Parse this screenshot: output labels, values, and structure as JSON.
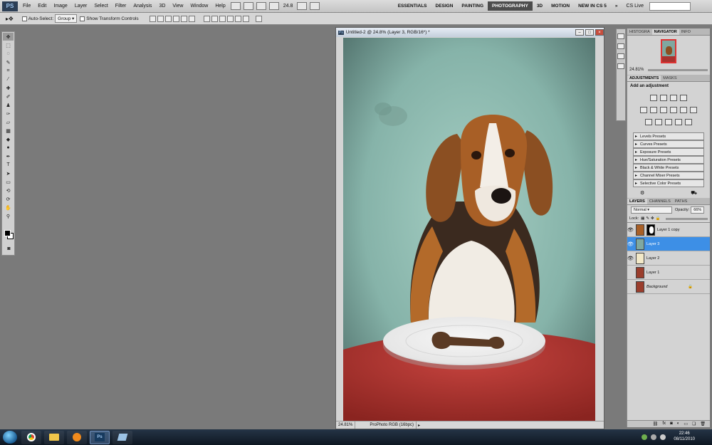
{
  "menubar": {
    "logo": "PS",
    "items": [
      "File",
      "Edit",
      "Image",
      "Layer",
      "Select",
      "Filter",
      "Analysis",
      "3D",
      "View",
      "Window",
      "Help"
    ],
    "zoom": "24.8",
    "workspaces": [
      "ESSENTIALS",
      "DESIGN",
      "PAINTING",
      "PHOTOGRAPHY",
      "3D",
      "MOTION",
      "NEW IN CS 5"
    ],
    "active_workspace": "PHOTOGRAPHY",
    "overflow": "»",
    "cs_live": "CS Live"
  },
  "options": {
    "auto_select_label": "Auto-Select:",
    "auto_select_value": "Group",
    "transform_label": "Show Transform Controls"
  },
  "document": {
    "title": "Untitled-2 @ 24.8% (Layer 3, RGB/16*) *",
    "ps_badge": "Ps",
    "status_zoom": "24.81%",
    "status_info": "ProPhoto RGB (16bpc)"
  },
  "navigator": {
    "tabs": [
      "HISTOGRA",
      "NAVIGATOR",
      "INFO"
    ],
    "active_tab": "NAVIGATOR",
    "zoom": "24.81%"
  },
  "adjustments": {
    "tabs": [
      "ADJUSTMENTS",
      "MASKS"
    ],
    "active_tab": "ADJUSTMENTS",
    "title": "Add an adjustment",
    "presets": [
      "Levels Presets",
      "Curves Presets",
      "Exposure Presets",
      "Hue/Saturation Presets",
      "Black & White Presets",
      "Channel Mixer Presets",
      "Selective Color Presets"
    ]
  },
  "layers_panel": {
    "tabs": [
      "LAYERS",
      "CHANNELS",
      "PATHS"
    ],
    "active_tab": "LAYERS",
    "blend_mode": "Normal",
    "opacity_label": "Opacity:",
    "opacity_value": "66%",
    "lock_label": "Lock:",
    "layers": [
      {
        "name": "Layer 1 copy",
        "visible": true,
        "active": false
      },
      {
        "name": "Layer 3",
        "visible": true,
        "active": true
      },
      {
        "name": "Layer 2",
        "visible": true,
        "active": false
      },
      {
        "name": "Layer 1",
        "visible": false,
        "active": false
      },
      {
        "name": "Background",
        "visible": false,
        "active": false
      }
    ]
  },
  "taskbar": {
    "time": "22:46",
    "date": "08/11/2010"
  },
  "colors": {
    "menubar_bg": "#c8c8c8",
    "workspace_active_bg": "#4d4d4d",
    "layer_active_bg": "#3d8fe6",
    "taskbar_bg": "#16202d"
  }
}
